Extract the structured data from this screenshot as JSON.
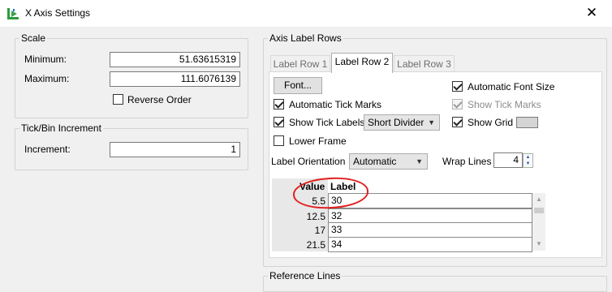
{
  "window": {
    "title": "X Axis Settings",
    "close_glyph": "✕",
    "app_icon": "jmp-axis-icon"
  },
  "scale": {
    "title": "Scale",
    "minimum_label": "Minimum:",
    "minimum_value": "51.63615319",
    "maximum_label": "Maximum:",
    "maximum_value": "111.6076139",
    "reverse_order_label": "Reverse Order",
    "reverse_order_checked": false
  },
  "tick_bin": {
    "title": "Tick/Bin Increment",
    "increment_label": "Increment:",
    "increment_value": "1"
  },
  "axis_label_rows": {
    "title": "Axis Label Rows",
    "tabs": [
      {
        "label": "Label Row 1",
        "active": false
      },
      {
        "label": "Label Row 2",
        "active": true
      },
      {
        "label": "Label Row 3",
        "active": false
      }
    ],
    "font_button": "Font...",
    "automatic_font_size": {
      "label": "Automatic Font Size",
      "checked": true
    },
    "automatic_tick_marks": {
      "label": "Automatic Tick Marks",
      "checked": true
    },
    "show_tick_marks": {
      "label": "Show Tick Marks",
      "checked": true,
      "disabled": true
    },
    "show_tick_labels": {
      "label": "Show Tick Labels",
      "checked": true
    },
    "tick_label_style": "Short Divider",
    "show_grid": {
      "label": "Show Grid",
      "checked": true
    },
    "lower_frame": {
      "label": "Lower Frame",
      "checked": false
    },
    "label_orientation_label": "Label Orientation",
    "label_orientation_value": "Automatic",
    "wrap_lines_label": "Wrap Lines",
    "wrap_lines_value": "4",
    "grid_headers": {
      "value": "Value",
      "label": "Label"
    },
    "rows": [
      {
        "value": "5.5",
        "label": "30"
      },
      {
        "value": "12.5",
        "label": "32"
      },
      {
        "value": "17",
        "label": "33"
      },
      {
        "value": "21.5",
        "label": "34"
      }
    ]
  },
  "reference_lines": {
    "title": "Reference Lines"
  },
  "colors": {
    "annotation": "#e0201f",
    "grid_swatch": "#d4d4d4"
  }
}
